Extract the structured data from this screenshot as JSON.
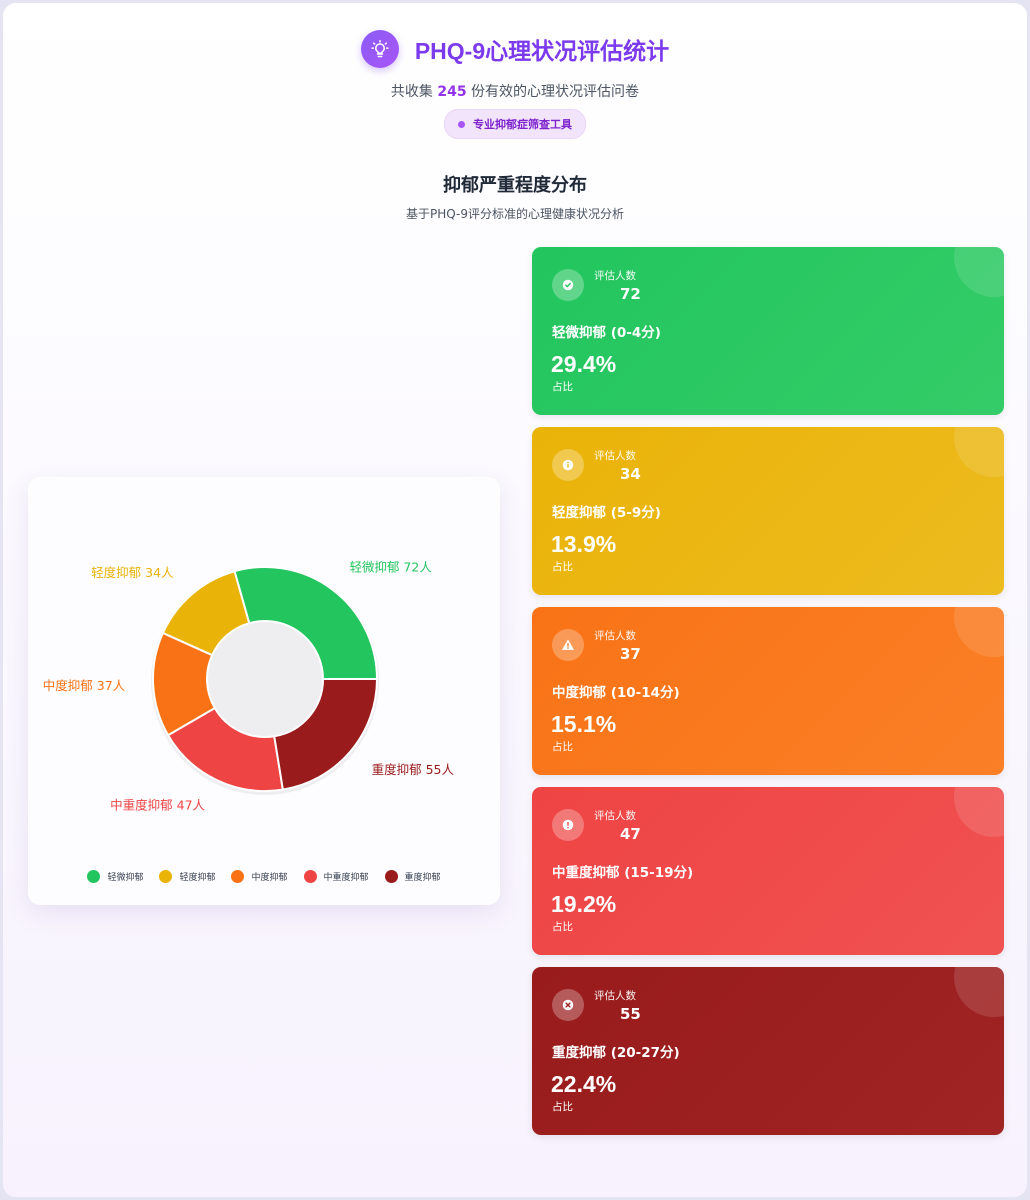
{
  "header": {
    "title": "PHQ-9心理状况评估统计",
    "subtitle_prefix": "共收集 ",
    "total": "245",
    "subtitle_suffix": " 份有效的心理状况评估问卷",
    "badge": "专业抑郁症筛查工具"
  },
  "section": {
    "title": "抑郁严重程度分布",
    "subtitle": "基于PHQ-9评分标准的心理健康状况分析"
  },
  "legend": [
    "轻微抑郁",
    "轻度抑郁",
    "中度抑郁",
    "中重度抑郁",
    "重度抑郁"
  ],
  "cards": [
    {
      "count_label": "评估人数",
      "count": "72",
      "label": "轻微抑郁 (0-4分)",
      "pct": "29.4%",
      "pct_label": "占比",
      "color": "#22c55e",
      "color2": "#34cc68",
      "icon": "check-circle-icon"
    },
    {
      "count_label": "评估人数",
      "count": "34",
      "label": "轻度抑郁 (5-9分)",
      "pct": "13.9%",
      "pct_label": "占比",
      "color": "#eab308",
      "color2": "#ecbb1f",
      "icon": "info-circle-icon"
    },
    {
      "count_label": "评估人数",
      "count": "37",
      "label": "中度抑郁 (10-14分)",
      "pct": "15.1%",
      "pct_label": "占比",
      "color": "#f97316",
      "color2": "#fa7f27",
      "icon": "warning-icon"
    },
    {
      "count_label": "评估人数",
      "count": "47",
      "label": "中重度抑郁 (15-19分)",
      "pct": "19.2%",
      "pct_label": "占比",
      "color": "#ef4444",
      "color2": "#f05252",
      "icon": "exclamation-circle-icon"
    },
    {
      "count_label": "评估人数",
      "count": "55",
      "label": "重度抑郁 (20-27分)",
      "pct": "22.4%",
      "pct_label": "占比",
      "color": "#991b1b",
      "color2": "#a02424",
      "icon": "x-circle-icon"
    }
  ],
  "chart_data": {
    "type": "pie",
    "variant": "donut",
    "categories": [
      "轻微抑郁",
      "轻度抑郁",
      "中度抑郁",
      "中重度抑郁",
      "重度抑郁"
    ],
    "values": [
      72,
      34,
      37,
      47,
      55
    ],
    "data_labels": [
      "轻微抑郁 72人",
      "轻度抑郁 34人",
      "中度抑郁 37人",
      "中重度抑郁 47人",
      "重度抑郁 55人"
    ],
    "colors": [
      "#22c55e",
      "#eab308",
      "#f97316",
      "#ef4444",
      "#991b1b"
    ],
    "start_angle": "3-o'clock",
    "direction": "counterclockwise",
    "legend_position": "bottom"
  }
}
